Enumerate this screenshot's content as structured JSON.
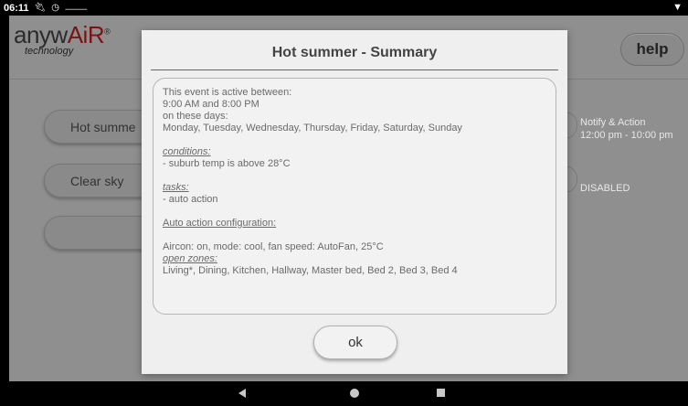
{
  "status_bar": {
    "time": "06:11",
    "icons": [
      "usb-icon",
      "alarm-icon",
      "wifi-off-icon",
      "signal-icon"
    ]
  },
  "header": {
    "logo_main_prefix": "anyw",
    "logo_main_accent": "AiR",
    "logo_trademark": "®",
    "logo_sub": "technology",
    "help_label": "help",
    "accent_color": "#7a1414"
  },
  "events": [
    {
      "label": "Hot summe",
      "status_line1": "Notify & Action",
      "status_line2": "12:00 pm - 10:00 pm"
    },
    {
      "label": "Clear sky",
      "status_line1": "DISABLED",
      "status_line2": ""
    },
    {
      "label": "+",
      "status_line1": "",
      "status_line2": ""
    }
  ],
  "dialog": {
    "title": "Hot summer - Summary",
    "active_intro": "This event is active between:",
    "active_times": "9:00 AM and 8:00 PM",
    "days_intro": "on these days:",
    "days": "Monday, Tuesday, Wednesday, Thursday, Friday, Saturday, Sunday",
    "conditions_heading": "conditions:",
    "conditions": "- suburb temp is above 28°C",
    "tasks_heading": "tasks:",
    "tasks": "- auto action",
    "auto_config_heading": "Auto action configuration:",
    "aircon_config": "Aircon: on, mode: cool, fan speed: AutoFan, 25°C",
    "open_zones_heading": "open zones:",
    "open_zones": "Living*, Dining, Kitchen, Hallway, Master bed, Bed 2, Bed 3, Bed 4",
    "ok_label": "ok"
  },
  "nav_bar": {
    "back_icon": "back-triangle-icon",
    "home_icon": "home-circle-icon",
    "recents_icon": "recents-square-icon"
  }
}
